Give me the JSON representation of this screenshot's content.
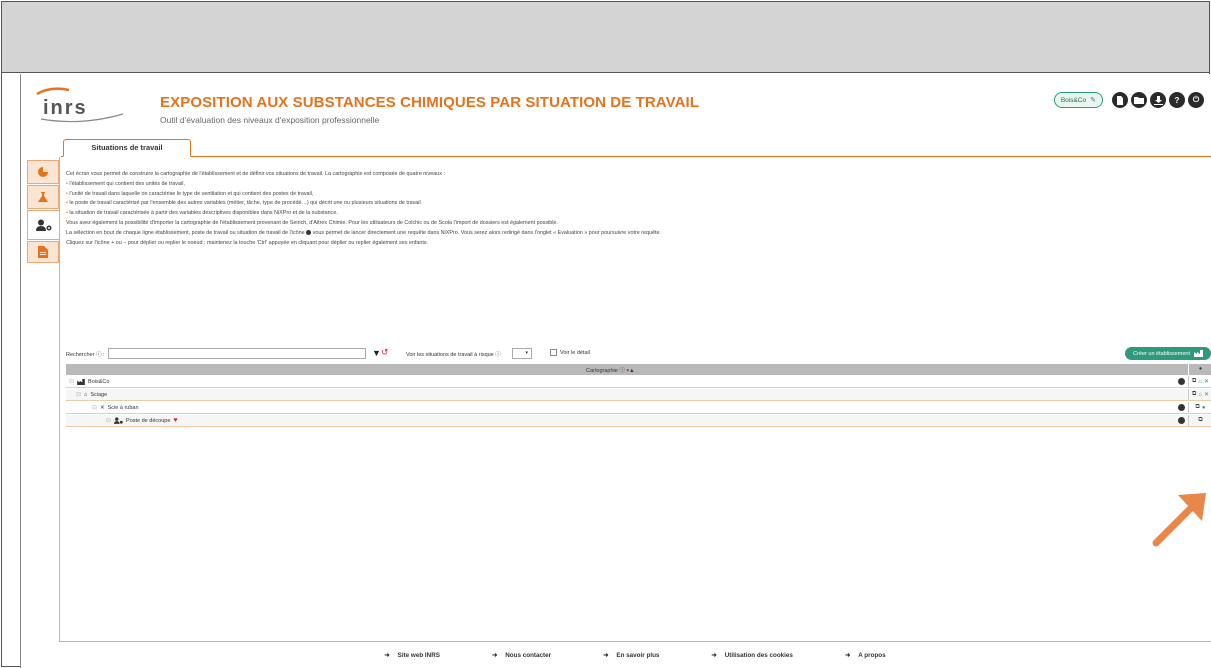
{
  "header": {
    "logo_text": "inrs",
    "title": "EXPOSITION AUX SUBSTANCES CHIMIQUES PAR SITUATION DE TRAVAIL",
    "subtitle": "Outil d'évaluation des niveaux d'exposition professionnelle",
    "company_chip": "Bois&Co",
    "icons": [
      "file-icon",
      "folder-icon",
      "download-icon",
      "help-icon",
      "power-icon"
    ]
  },
  "tab": {
    "label": "Situations de travail"
  },
  "sidebar": {
    "items": [
      {
        "icon": "pie-chart-icon"
      },
      {
        "icon": "flask-icon"
      },
      {
        "icon": "user-gear-icon"
      },
      {
        "icon": "document-icon"
      }
    ]
  },
  "intro": {
    "line1": "Cet écran vous permet de construire la cartographie de l'établissement et de définir vos situations de travail. La cartographie est composée de quatre niveaux :",
    "bullet1": "l'établissement qui contient des unités de travail,",
    "bullet2": "l'unité de travail dans laquelle on caractérise le type de ventilation et qui contient des postes de travail,",
    "bullet3": "le poste de travail caractérisé par l'ensemble des autres variables (métier, tâche, type de procédé…) qui décrit une ou plusieurs situations de travail",
    "bullet4": "la situation de travail caractérisée à partir des variables descriptives disponibles dans NiXPro et de la substance.",
    "line2": "Vous avez également la possibilité d'importer la cartographie de l'établissement provenant de Seirich, d'Altrex Chimie. Pour les utilisateurs de Colchic ou de Scola l'import de dossiers est également possible.",
    "line3a": "La sélection en bout de chaque ligne établissement, poste de travail ou situation de travail de l'icône",
    "line3b": "vous permet de lancer directement une requête dans NiXPro. Vous serez alors redirigé dans l'onglet « Evaluation » pour poursuivre votre requête.",
    "line4": "Cliquez sur l'icône + ou − pour déplier ou replier le noeud ; maintenez la touche 'Ctrl' appuyée en cliquant pour déplier ou replier également ses enfants."
  },
  "search": {
    "label": "Rechercher ⓘ :",
    "value": "",
    "risk_label": "Voir les situations de travail à risque ⓘ",
    "risk_value": "▾",
    "detail_label": "Voir le détail",
    "create_button": "Créer un établissement"
  },
  "table": {
    "header": "Cartographie ⓘ",
    "sort_marks": "▲",
    "rows": [
      {
        "label": "Bois&Co",
        "icon": "factory-icon"
      },
      {
        "label": "Sciage",
        "icon": "home-icon"
      },
      {
        "label": "Scie à ruban",
        "icon": "tools-icon"
      },
      {
        "label": "Poste de découpe",
        "icon": "user-gear-icon"
      }
    ]
  },
  "footer": {
    "links": [
      "Site web INRS",
      "Nous contacter",
      "En savoir plus",
      "Utilisation des cookies",
      "A propos"
    ]
  },
  "colors": {
    "accent": "#e8711c",
    "green": "#2d9b7b",
    "danger": "#d9232d"
  }
}
